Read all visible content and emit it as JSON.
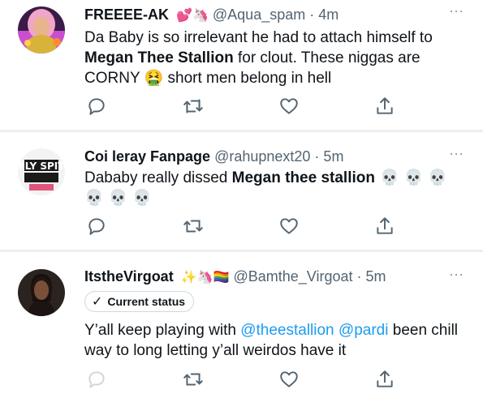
{
  "tweets": [
    {
      "display_name": "FREEEE-AK",
      "name_emojis": "💕🦄",
      "handle_time": "@Aqua_spam · 4m",
      "text_parts": [
        "Da Baby is so irrelevant he had to attach himself to ",
        "Megan Thee Stallion",
        " for clout. These niggas are CORNY ",
        "🤮",
        " short men belong in hell"
      ]
    },
    {
      "display_name": "Coi leray Fanpage",
      "handle_time": "@rahupnext20 · 5m",
      "avatar_text": "FLY SPIT",
      "text_parts": [
        "Dababy really dissed ",
        "Megan thee stallion",
        " 💀 💀 💀 💀 💀 💀"
      ]
    },
    {
      "display_name": "ItstheVirgoat",
      "name_emojis": "✨🦄🏳️‍🌈",
      "handle_time": "@Bamthe_Virgoat · 5m",
      "status_label": "Current status",
      "text_parts": [
        "Y’all keep playing with ",
        "@theestallion",
        " ",
        "@pardi",
        " been chill way to long letting y’all weirdos have it"
      ]
    }
  ],
  "more_label": "···",
  "icons": {
    "reply": "reply-icon",
    "retweet": "retweet-icon",
    "like": "like-icon",
    "share": "share-icon",
    "check": "check-icon"
  },
  "colors": {
    "text": "#0f1419",
    "secondary": "#536471",
    "mention": "#1d9bf0",
    "divider": "#eaeff2"
  }
}
